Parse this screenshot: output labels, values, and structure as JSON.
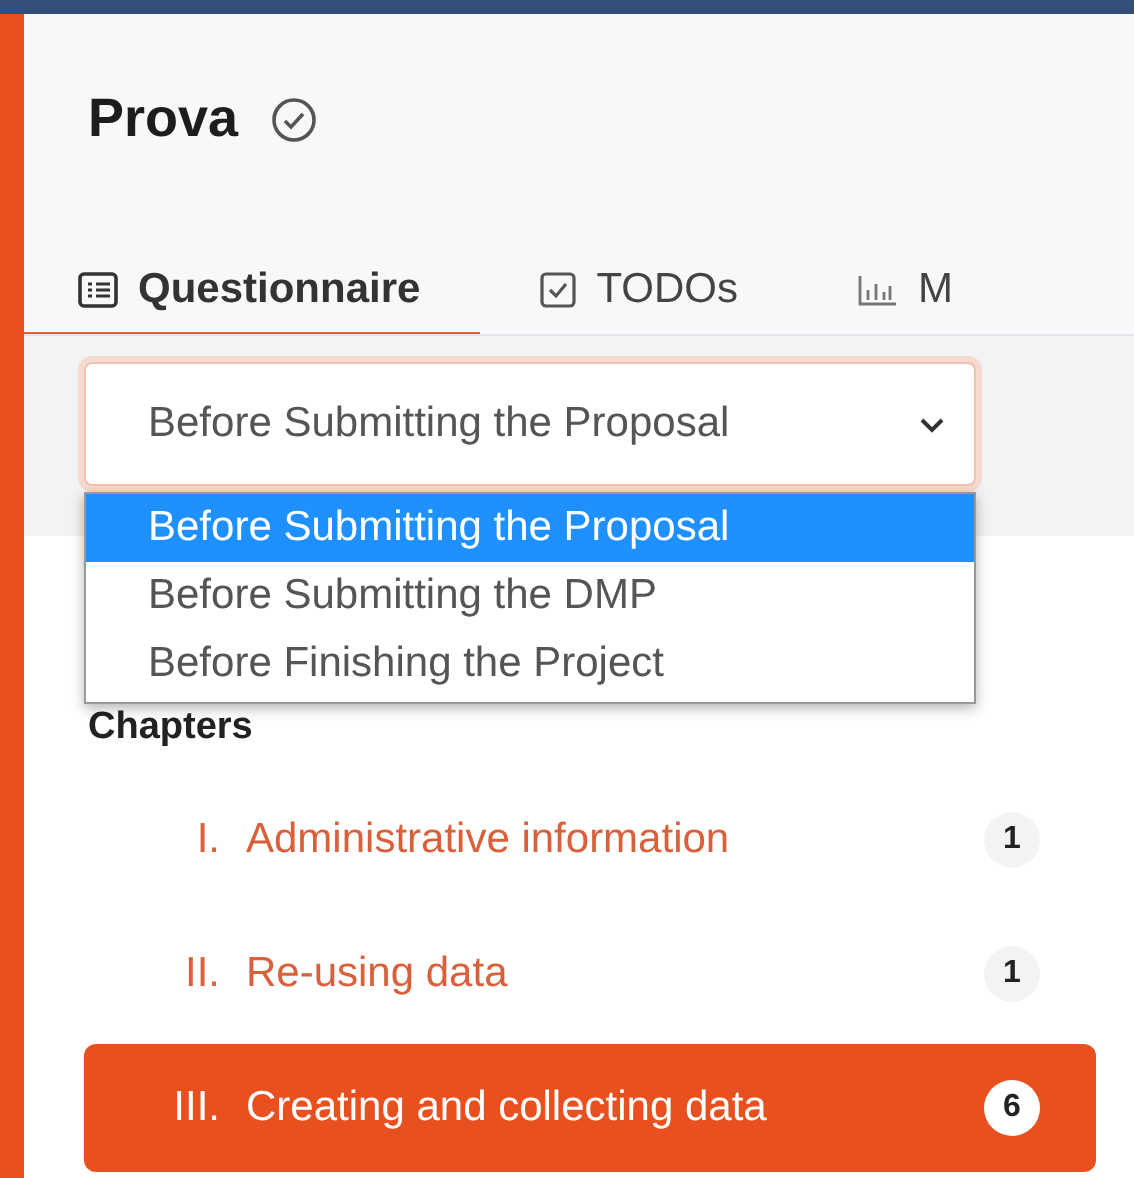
{
  "project": {
    "title": "Prova"
  },
  "tabs": [
    {
      "label": "Questionnaire",
      "selected": true
    },
    {
      "label": "TODOs",
      "selected": false
    },
    {
      "label": "M",
      "selected": false
    }
  ],
  "phase_select": {
    "value": "Before Submitting the Proposal",
    "expanded": true,
    "options": [
      {
        "label": "Before Submitting the Proposal",
        "selected": true
      },
      {
        "label": "Before Submitting the DMP",
        "selected": false
      },
      {
        "label": "Before Finishing the Project",
        "selected": false
      }
    ]
  },
  "chapters": {
    "heading": "Chapters",
    "items": [
      {
        "number": "I.",
        "title": "Administrative information",
        "count": "1",
        "selected": false
      },
      {
        "number": "II.",
        "title": "Re-using data",
        "count": "1",
        "selected": false
      },
      {
        "number": "III.",
        "title": "Creating and collecting data",
        "count": "6",
        "selected": true
      }
    ]
  }
}
